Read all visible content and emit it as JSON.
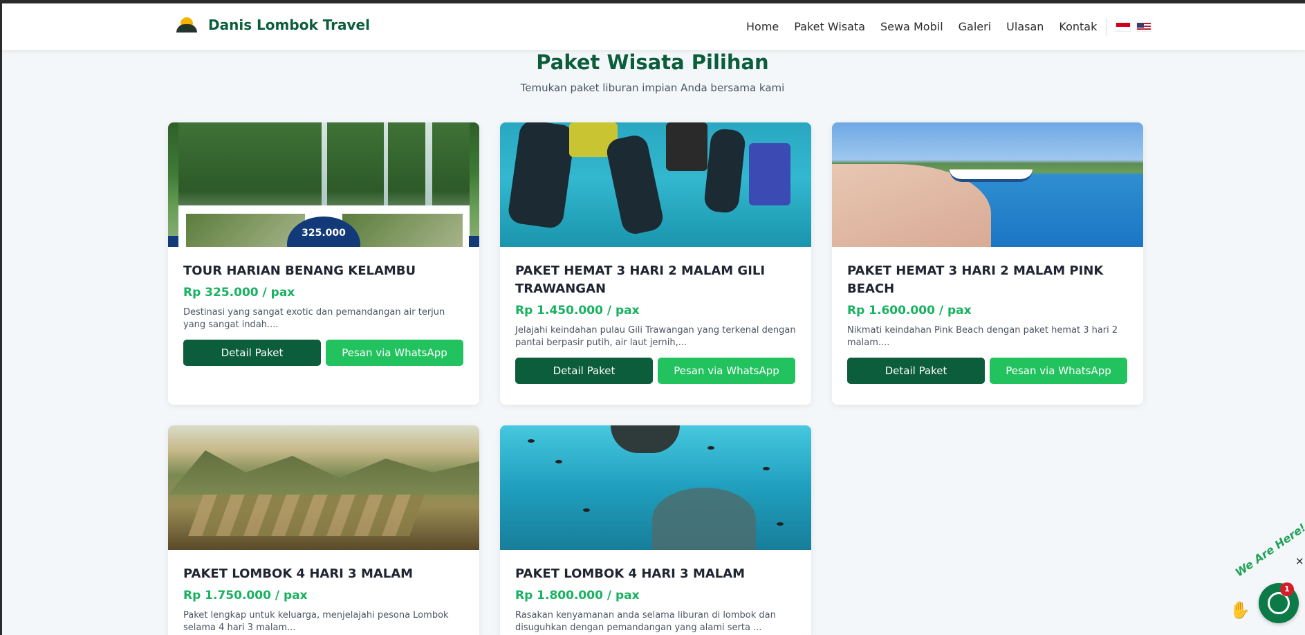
{
  "brand": {
    "name": "Danis Lombok Travel",
    "logo_icon": "sun-hill-logo-icon"
  },
  "nav": {
    "items": [
      "Home",
      "Paket Wisata",
      "Sewa Mobil",
      "Galeri",
      "Ulasan",
      "Kontak"
    ],
    "languages": [
      "flag-id-icon",
      "flag-us-icon"
    ]
  },
  "section": {
    "title": "Paket Wisata Pilihan",
    "subtitle": "Temukan paket liburan impian Anda bersama kami"
  },
  "cards": [
    {
      "title": "TOUR HARIAN BENANG KELAMBU",
      "price": "Rp 325.000 / pax",
      "desc": "Destinasi yang sangat exotic dan pemandangan air terjun yang sangat indah....",
      "image_badge": "325.000",
      "detail_label": "Detail Paket",
      "wa_label": "Pesan via WhatsApp"
    },
    {
      "title": "PAKET HEMAT 3 HARI 2 MALAM GILI TRAWANGAN",
      "price": "Rp 1.450.000 / pax",
      "desc": "Jelajahi keindahan pulau Gili Trawangan yang terkenal dengan pantai berpasir putih, air laut jernih,...",
      "detail_label": "Detail Paket",
      "wa_label": "Pesan via WhatsApp"
    },
    {
      "title": "PAKET HEMAT 3 HARI 2 MALAM PINK BEACH",
      "price": "Rp 1.600.000 / pax",
      "desc": "Nikmati keindahan Pink Beach dengan paket hemat 3 hari 2 malam....",
      "detail_label": "Detail Paket",
      "wa_label": "Pesan via WhatsApp"
    },
    {
      "title": "PAKET LOMBOK 4 HARI 3 MALAM",
      "price": "Rp 1.750.000 / pax",
      "desc": "Paket lengkap untuk keluarga, menjelajahi pesona Lombok selama 4 hari 3 malam..."
    },
    {
      "title": "PAKET LOMBOK 4 HARI 3 MALAM",
      "price": "Rp 1.800.000 / pax",
      "desc": "Rasakan kenyamanan anda selama liburan di lombok dan disuguhkan dengan pemandangan yang alami serta ..."
    }
  ],
  "chat_widget": {
    "tagline": "We Are Here!",
    "close": "×",
    "badge_count": "1",
    "icon": "whatsapp-chat-icon"
  },
  "colors": {
    "brand_green": "#0b5d3b",
    "price_green": "#16b25f",
    "wa_green": "#22c25f",
    "page_bg": "#f4f7f9"
  }
}
